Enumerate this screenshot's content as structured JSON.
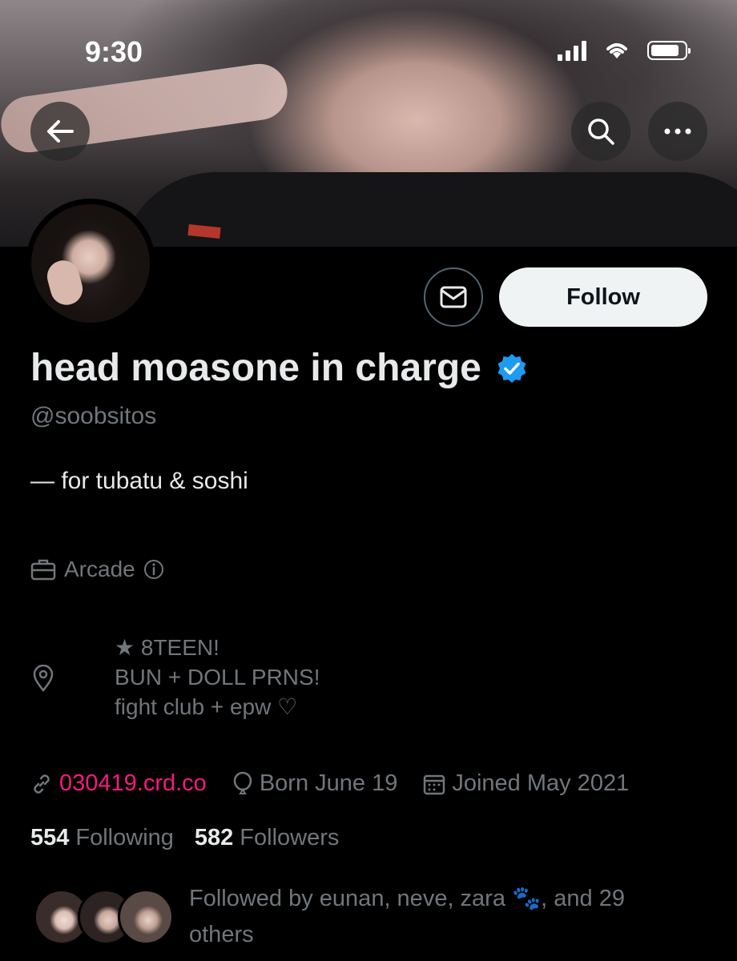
{
  "status_bar": {
    "time": "9:30"
  },
  "header": {
    "back_icon": "arrow-left-icon",
    "search_icon": "search-icon",
    "more_icon": "more-dots-icon"
  },
  "actions": {
    "message_icon": "envelope-icon",
    "follow_label": "Follow"
  },
  "profile": {
    "display_name": "head moasone in charge",
    "verified_color": "#1d9bf0",
    "handle": "@soobsitos",
    "bio": "— for tubatu & soshi",
    "professional_category": "Arcade",
    "location_lines": [
      "★ 8TEEN!",
      "BUN + DOLL PRNS!",
      "fight club + epw ♡"
    ],
    "website": "030419.crd.co",
    "birthday": "Born June 19",
    "joined": "Joined May 2021"
  },
  "stats": {
    "following_count": "554",
    "following_label": "Following",
    "followers_count": "582",
    "followers_label": "Followers"
  },
  "followed_by": {
    "text_prefix": "Followed by eunan, neve, zara",
    "emoji": "🐾",
    "text_suffix": ", and 29 others"
  },
  "colors": {
    "background": "#000000",
    "link": "#f91880",
    "secondary_text": "#71767b"
  }
}
